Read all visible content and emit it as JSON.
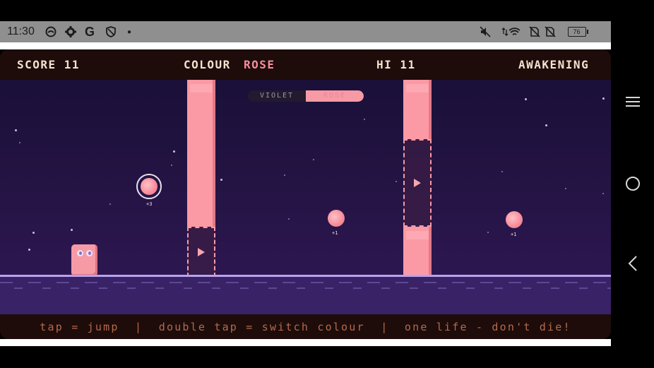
{
  "status_bar": {
    "time": "11:30",
    "left_icons": [
      "circle-icon",
      "gear-icon",
      "google-icon",
      "shield-icon",
      "dot-icon"
    ],
    "right_icons": [
      "mute-icon",
      "wifi-icon",
      "no-sim-icon",
      "no-sim-icon",
      "battery-icon"
    ],
    "battery": "76"
  },
  "hud": {
    "score_label": "SCORE 11",
    "colour_label": "COLOUR",
    "colour_value": "ROSE",
    "hi_label": "HI 11",
    "stage": "AWAKENING"
  },
  "toggle": {
    "left": "VIOLET",
    "right": "ROSE",
    "active": "ROSE"
  },
  "orbs": [
    {
      "label": "+3",
      "ringed": true
    },
    {
      "label": "+1",
      "ringed": false
    },
    {
      "label": "+1",
      "ringed": false
    }
  ],
  "footer": {
    "hint": "tap = jump  |  double tap = switch colour  |  one life - don't die!"
  },
  "colors": {
    "rose": "#fb9aa5",
    "violet": "#2b1652",
    "hud_text": "#f3e2cf",
    "footer_text": "#b56a4c"
  },
  "nav": [
    "menu-icon",
    "home-icon",
    "back-icon"
  ]
}
